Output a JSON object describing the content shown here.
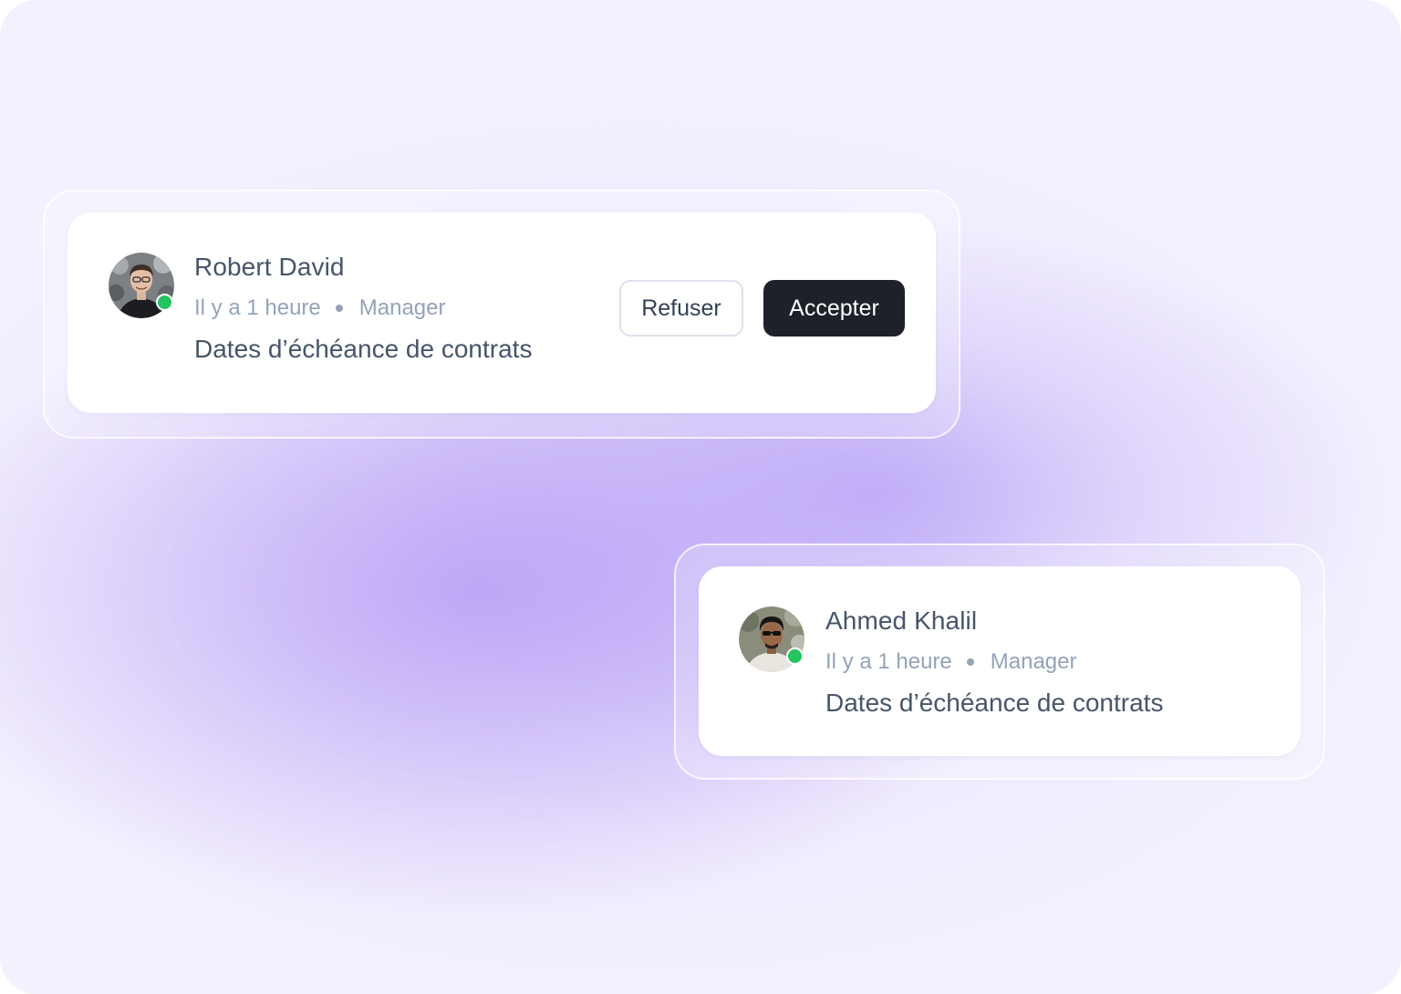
{
  "notifications": [
    {
      "name": "Robert David",
      "time": "Il y a 1 heure",
      "role": "Manager",
      "message": "Dates d’échéance de contrats",
      "online": true,
      "actions": {
        "refuse_label": "Refuser",
        "accept_label": "Accepter"
      }
    },
    {
      "name": "Ahmed Khalil",
      "time": "Il y a 1 heure",
      "role": "Manager",
      "message": "Dates d’échéance de contrats",
      "online": true
    }
  ],
  "colors": {
    "status_online": "#22c55e",
    "accept_button": "#1e2129",
    "text_primary": "#475569",
    "text_muted": "#94a3b8"
  }
}
